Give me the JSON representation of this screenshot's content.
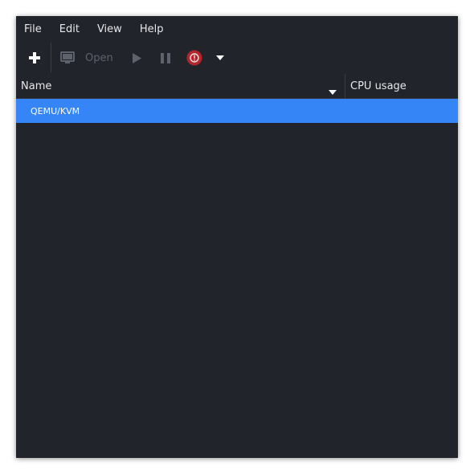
{
  "menubar": {
    "items": [
      {
        "label": "File"
      },
      {
        "label": "Edit"
      },
      {
        "label": "View"
      },
      {
        "label": "Help"
      }
    ]
  },
  "toolbar": {
    "new_icon": "plus-icon",
    "console_icon": "monitor-icon",
    "open_label": "Open",
    "run_icon": "play-icon",
    "pause_icon": "pause-icon",
    "shutdown_icon": "power-icon",
    "shutdown_menu_icon": "chevron-down-icon",
    "colors": {
      "enabled": "#ffffff",
      "disabled": "#5e626d",
      "shutdown": "#b3262c"
    }
  },
  "list": {
    "columns": [
      {
        "label": "Name"
      },
      {
        "label": "CPU usage"
      }
    ],
    "rows": [
      {
        "label": "QEMU/KVM",
        "selected": true
      }
    ]
  },
  "colors": {
    "window_bg": "#22242c",
    "selection": "#3585f7",
    "text": "#e6e7ea"
  }
}
